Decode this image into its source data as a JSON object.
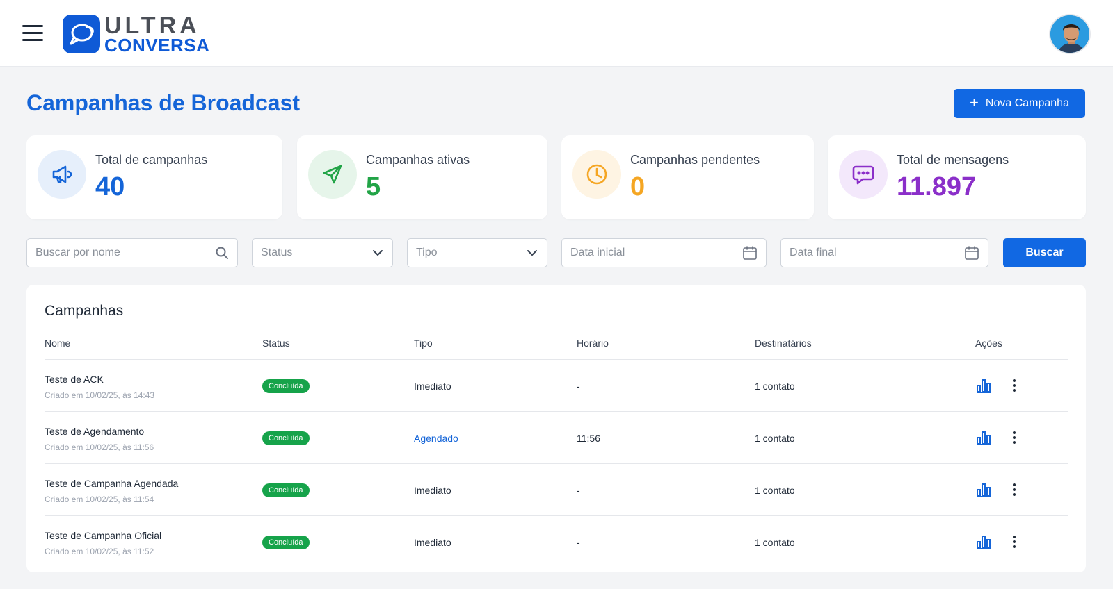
{
  "header": {
    "logo_line1": "ULTRA",
    "logo_line2": "CONVERSA",
    "brand_color": "#0f5ad6"
  },
  "page": {
    "title": "Campanhas de Broadcast",
    "new_button_label": "Nova Campanha"
  },
  "stats": [
    {
      "label": "Total de campanhas",
      "value": "40",
      "icon": "megaphone-icon",
      "color": "#1565d8",
      "bg": "#e6effb"
    },
    {
      "label": "Campanhas ativas",
      "value": "5",
      "icon": "paper-plane-icon",
      "color": "#22a447",
      "bg": "#e6f5ea"
    },
    {
      "label": "Campanhas pendentes",
      "value": "0",
      "icon": "clock-icon",
      "color": "#f5a623",
      "bg": "#fef4e3"
    },
    {
      "label": "Total de mensagens",
      "value": "11.897",
      "icon": "chat-bubble-icon",
      "color": "#8b2fc9",
      "bg": "#f3e8fb"
    }
  ],
  "filters": {
    "search_placeholder": "Buscar por nome",
    "status_placeholder": "Status",
    "tipo_placeholder": "Tipo",
    "start_date_placeholder": "Data inicial",
    "end_date_placeholder": "Data final",
    "search_button": "Buscar"
  },
  "table": {
    "title": "Campanhas",
    "columns": [
      "Nome",
      "Status",
      "Tipo",
      "Horário",
      "Destinatários",
      "Ações"
    ],
    "rows": [
      {
        "name": "Teste de ACK",
        "created": "Criado em 10/02/25, às 14:43",
        "status": "Concluída",
        "tipo": "Imediato",
        "horario": "-",
        "destinatarios": "1 contato"
      },
      {
        "name": "Teste de Agendamento",
        "created": "Criado em 10/02/25, às 11:56",
        "status": "Concluída",
        "tipo": "Agendado",
        "horario": "11:56",
        "destinatarios": "1 contato"
      },
      {
        "name": "Teste de Campanha Agendada",
        "created": "Criado em 10/02/25, às 11:54",
        "status": "Concluída",
        "tipo": "Imediato",
        "horario": "-",
        "destinatarios": "1 contato"
      },
      {
        "name": "Teste de Campanha Oficial",
        "created": "Criado em 10/02/25, às 11:52",
        "status": "Concluída",
        "tipo": "Imediato",
        "horario": "-",
        "destinatarios": "1 contato"
      }
    ]
  }
}
